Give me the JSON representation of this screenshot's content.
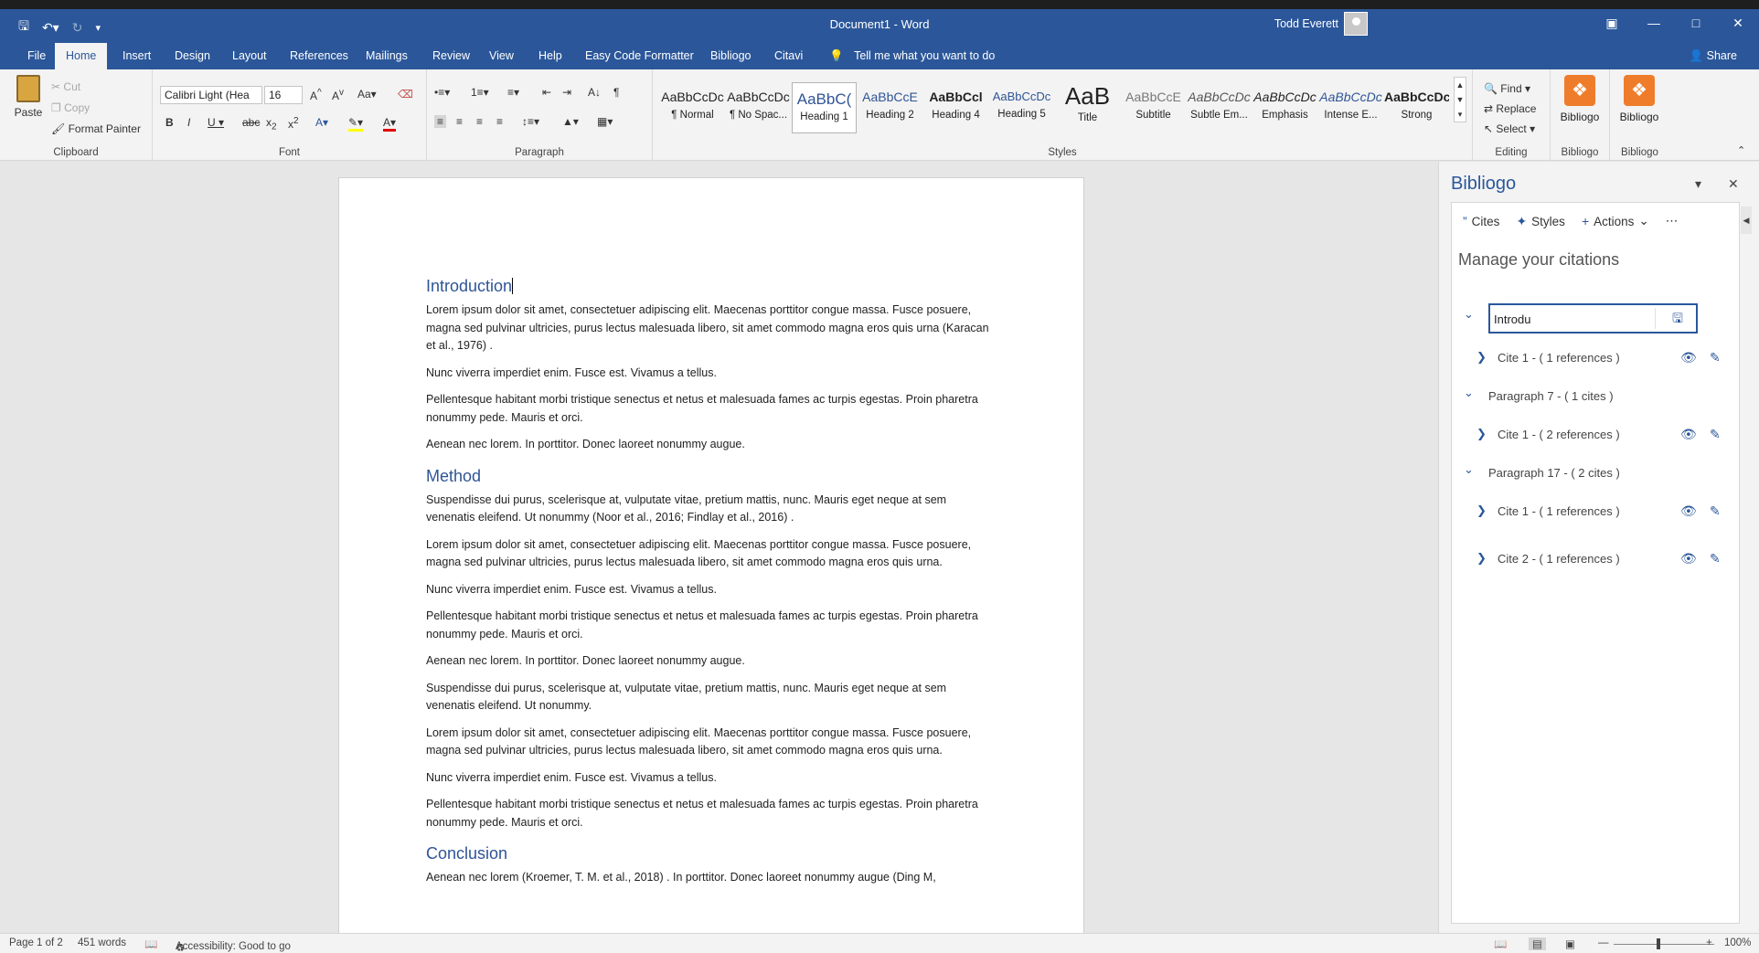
{
  "app": {
    "title": "Document1  -  Word",
    "user": "Todd Everett",
    "share": "Share"
  },
  "tabs": [
    "File",
    "Home",
    "Insert",
    "Design",
    "Layout",
    "References",
    "Mailings",
    "Review",
    "View",
    "Help",
    "Easy Code Formatter",
    "Bibliogo",
    "Citavi"
  ],
  "tell_me": "Tell me what you want to do",
  "ribbon": {
    "clipboard": {
      "label": "Clipboard",
      "paste": "Paste",
      "cut": "Cut",
      "copy": "Copy",
      "format_painter": "Format Painter"
    },
    "font": {
      "label": "Font",
      "font_name": "Calibri Light (Hea",
      "font_size": "16"
    },
    "paragraph": {
      "label": "Paragraph"
    },
    "styles": {
      "label": "Styles",
      "items": [
        {
          "preview": "AaBbCcDc",
          "name": "¶ Normal"
        },
        {
          "preview": "AaBbCcDc",
          "name": "¶ No Spac..."
        },
        {
          "preview": "AaBbC(",
          "name": "Heading 1"
        },
        {
          "preview": "AaBbCcE",
          "name": "Heading 2"
        },
        {
          "preview": "AaBbCcl",
          "name": "Heading 4"
        },
        {
          "preview": "AaBbCcDc",
          "name": "Heading 5"
        },
        {
          "preview": "AaB",
          "name": "Title"
        },
        {
          "preview": "AaBbCcE",
          "name": "Subtitle"
        },
        {
          "preview": "AaBbCcDc",
          "name": "Subtle Em..."
        },
        {
          "preview": "AaBbCcDc",
          "name": "Emphasis"
        },
        {
          "preview": "AaBbCcDc",
          "name": "Intense E..."
        },
        {
          "preview": "AaBbCcDc",
          "name": "Strong"
        }
      ]
    },
    "editing": {
      "label": "Editing",
      "find": "Find",
      "replace": "Replace",
      "select": "Select"
    },
    "bibliogo1": {
      "label": "Bibliogo",
      "button": "Bibliogo"
    },
    "bibliogo2": {
      "label": "Bibliogo",
      "button": "Bibliogo"
    }
  },
  "document": {
    "h_intro": "Introduction",
    "p1": "Lorem ipsum dolor sit amet, consectetuer adipiscing elit. Maecenas porttitor congue massa. Fusce posuere, magna sed pulvinar ultricies, purus lectus malesuada libero, sit amet commodo magna eros quis urna (Karacan et al., 1976) .",
    "p2": "Nunc viverra imperdiet enim. Fusce est. Vivamus a tellus.",
    "p3": "Pellentesque habitant morbi tristique senectus et netus et malesuada fames ac turpis egestas. Proin pharetra nonummy pede. Mauris et orci.",
    "p4": "Aenean nec lorem. In porttitor. Donec laoreet nonummy augue.",
    "h_method": "Method",
    "p5": "Suspendisse dui purus, scelerisque at, vulputate vitae, pretium mattis, nunc. Mauris eget neque at sem venenatis eleifend. Ut nonummy (Noor et al., 2016; Findlay et al., 2016) .",
    "p6": "Lorem ipsum dolor sit amet, consectetuer adipiscing elit. Maecenas porttitor congue massa. Fusce posuere, magna sed pulvinar ultricies, purus lectus malesuada libero, sit amet commodo magna eros quis urna.",
    "p7": "Nunc viverra imperdiet enim. Fusce est. Vivamus a tellus.",
    "p8": "Pellentesque habitant morbi tristique senectus et netus et malesuada fames ac turpis egestas. Proin pharetra nonummy pede. Mauris et orci.",
    "p9": "Aenean nec lorem. In porttitor. Donec laoreet nonummy augue.",
    "p10": "Suspendisse dui purus, scelerisque at, vulputate vitae, pretium mattis, nunc. Mauris eget neque at sem venenatis eleifend. Ut nonummy.",
    "p11": "Lorem ipsum dolor sit amet, consectetuer adipiscing elit. Maecenas porttitor congue massa. Fusce posuere, magna sed pulvinar ultricies, purus lectus malesuada libero, sit amet commodo magna eros quis urna.",
    "p12": "Nunc viverra imperdiet enim. Fusce est. Vivamus a tellus.",
    "p13": "Pellentesque habitant morbi tristique senectus et netus et malesuada fames ac turpis egestas. Proin pharetra nonummy pede. Mauris et orci.",
    "h_conclusion": "Conclusion",
    "p14": "Aenean nec lorem (Kroemer, T. M. et al., 2018) . In porttitor. Donec laoreet nonummy augue (Ding M,"
  },
  "pane": {
    "title": "Bibliogo",
    "cmd_cites": "Cites",
    "cmd_styles": "Styles",
    "cmd_actions": "Actions",
    "heading": "Manage your citations",
    "edit_value": "Introdu",
    "rows": [
      {
        "label": "Cite 1 - ( 1 references )"
      },
      {
        "label": "Paragraph 7 - ( 1 cites )"
      },
      {
        "label": "Cite 1 - ( 2 references )"
      },
      {
        "label": "Paragraph 17 - ( 2 cites )"
      },
      {
        "label": "Cite 1 - ( 1 references )"
      },
      {
        "label": "Cite 2 - ( 1 references )"
      }
    ]
  },
  "status": {
    "page": "Page 1 of 2",
    "words": "451 words",
    "accessibility": "Accessibility: Good to go",
    "zoom": "100%"
  }
}
